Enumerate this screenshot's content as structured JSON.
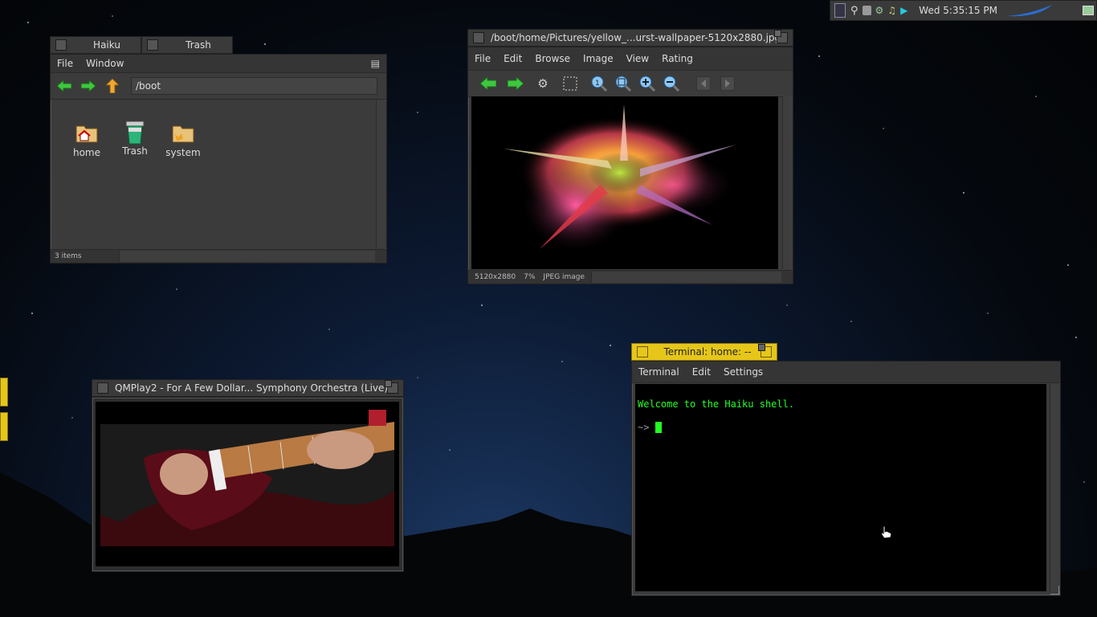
{
  "deskbar": {
    "clock": "Wed 5:35:15 PM"
  },
  "tracker": {
    "tabs": [
      {
        "title": "Haiku"
      },
      {
        "title": "Trash"
      }
    ],
    "menu": [
      "File",
      "Window"
    ],
    "path": "/boot",
    "items": [
      {
        "label": "home",
        "icon": "home-folder-icon"
      },
      {
        "label": "Trash",
        "icon": "trash-icon"
      },
      {
        "label": "system",
        "icon": "system-folder-icon"
      }
    ],
    "status": "3 items"
  },
  "showimage": {
    "title": "/boot/home/Pictures/yellow_...urst-wallpaper-5120x2880.jpg",
    "menu": [
      "File",
      "Edit",
      "Browse",
      "Image",
      "View",
      "Rating"
    ],
    "status_size": "5120x2880",
    "status_zoom": "7%",
    "status_type": "JPEG image"
  },
  "terminal": {
    "title": "Terminal: home: --",
    "menu": [
      "Terminal",
      "Edit",
      "Settings"
    ],
    "line1": "Welcome to the Haiku shell.",
    "prompt": "~>",
    "colors": {
      "tab": "#e6c619",
      "text": "#22ff22"
    }
  },
  "qmplay": {
    "title": "QMPlay2 - For A Few Dollar... Symphony Orchestra (Live)"
  }
}
